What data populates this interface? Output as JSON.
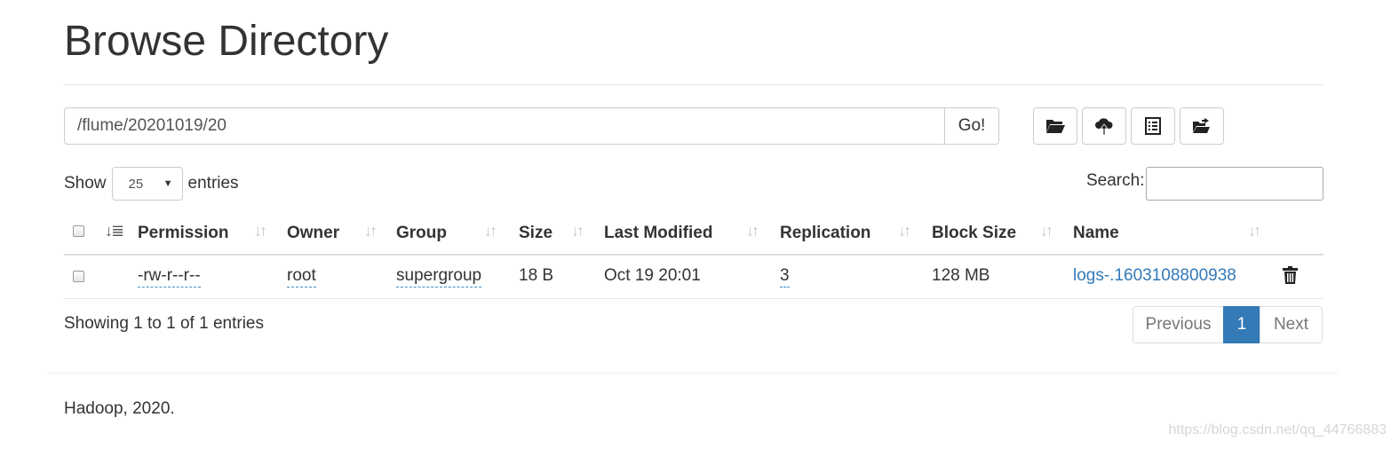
{
  "page_title": "Browse Directory",
  "path_bar": {
    "value": "/flume/20201019/20",
    "go_label": "Go!"
  },
  "toolbar": {
    "buttons": [
      {
        "icon": "folder-open-icon"
      },
      {
        "icon": "cloud-upload-icon"
      },
      {
        "icon": "list-alt-icon"
      },
      {
        "icon": "folder-move-icon"
      }
    ]
  },
  "length_control": {
    "show_label": "Show",
    "selected": "25",
    "entries_label": "entries"
  },
  "search": {
    "label": "Search:",
    "value": ""
  },
  "table": {
    "columns": [
      "Permission",
      "Owner",
      "Group",
      "Size",
      "Last Modified",
      "Replication",
      "Block Size",
      "Name"
    ],
    "rows": [
      {
        "permission": "-rw-r--r--",
        "owner": "root",
        "group": "supergroup",
        "size": "18 B",
        "last_modified": "Oct 19 20:01",
        "replication": "3",
        "block_size": "128 MB",
        "name": "logs-.1603108800938"
      }
    ]
  },
  "info": "Showing 1 to 1 of 1 entries",
  "pagination": {
    "previous": "Previous",
    "current": "1",
    "next": "Next"
  },
  "footer": "Hadoop, 2020.",
  "watermark": "https://blog.csdn.net/qq_44766883",
  "colors": {
    "link": "#337ab7",
    "active_page": "#337ab7"
  }
}
